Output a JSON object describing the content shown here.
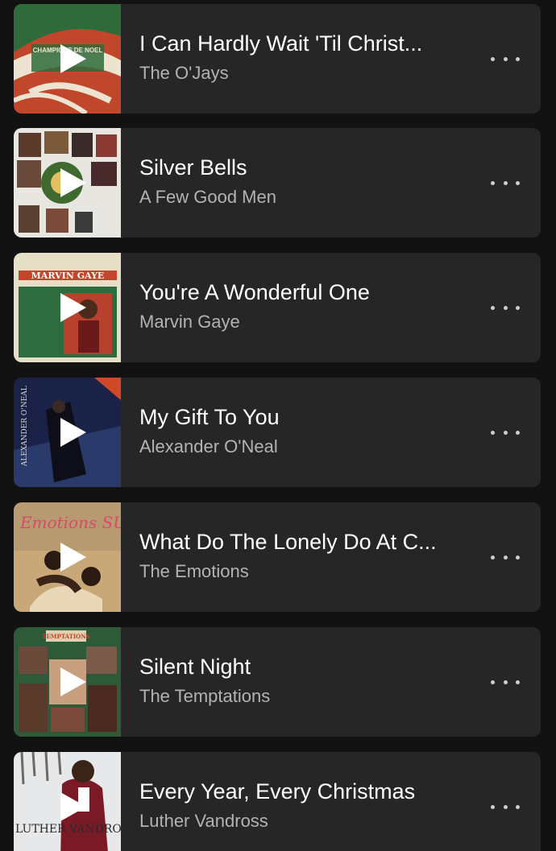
{
  "tracks": [
    {
      "title": "I Can Hardly Wait 'Til Christ...",
      "artist": "The O'Jays",
      "art": "christmas-card-art",
      "art_text": "CHAMPIONS DE NOEL"
    },
    {
      "title": "Silver Bells",
      "artist": "A Few Good Men",
      "art": "photo-collage-art",
      "art_text": ""
    },
    {
      "title": "You're A Wonderful One",
      "artist": "Marvin Gaye",
      "art": "marvin-gaye-album-art",
      "art_text": "MARVIN GAYE"
    },
    {
      "title": "My Gift To You",
      "artist": "Alexander O'Neal",
      "art": "alexander-oneal-album-art",
      "art_text": "ALEXANDER O'NEAL"
    },
    {
      "title": "What Do The Lonely Do At C...",
      "artist": "The Emotions",
      "art": "emotions-sunshine-album-art",
      "art_text": "Emotions SUNSHINE"
    },
    {
      "title": "Silent Night",
      "artist": "The Temptations",
      "art": "temptations-album-art",
      "art_text": "TEMPTATIONS"
    },
    {
      "title": "Every Year, Every Christmas",
      "artist": "Luther Vandross",
      "art": "luther-vandross-album-art",
      "art_text": "LUTHER VANDROSS"
    }
  ],
  "icons": {
    "play": "play-icon",
    "more": "more-options-icon"
  },
  "colors": {
    "background": "#121212",
    "card": "#262626",
    "title": "#ffffff",
    "subtitle": "#b3b3b3"
  }
}
